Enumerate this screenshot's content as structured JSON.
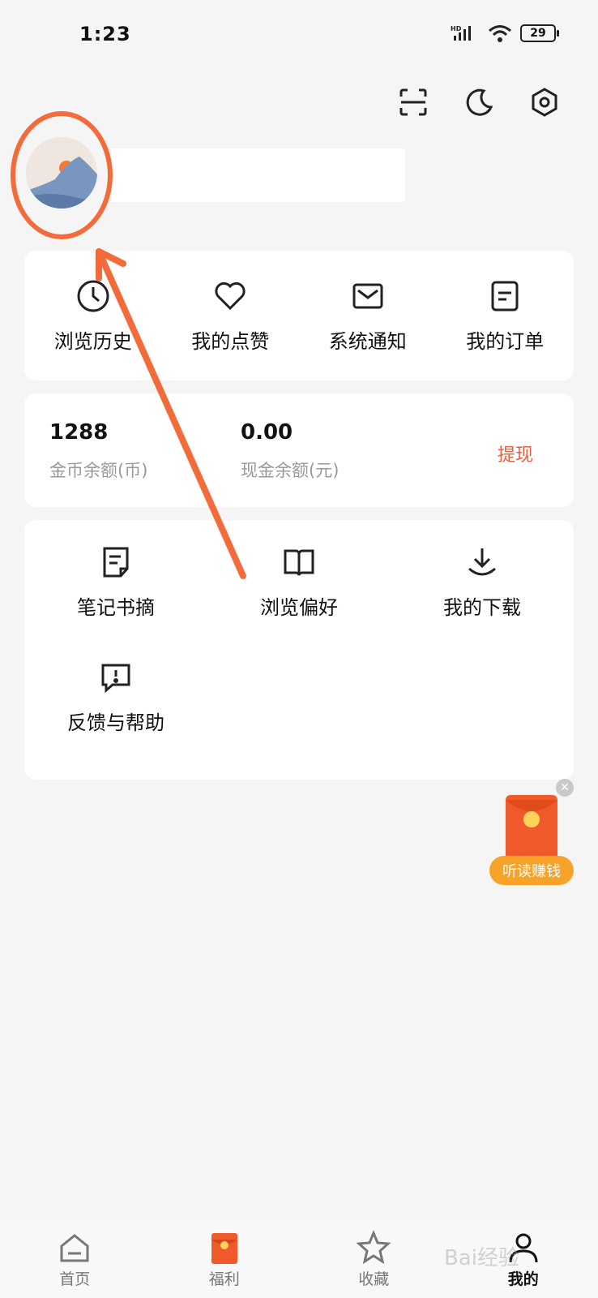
{
  "status_bar": {
    "time": "1:23",
    "battery": "29",
    "network": "HD"
  },
  "quick_actions": [
    {
      "label": "浏览历史",
      "icon": "clock-icon"
    },
    {
      "label": "我的点赞",
      "icon": "heart-icon"
    },
    {
      "label": "系统通知",
      "icon": "mail-icon"
    },
    {
      "label": "我的订单",
      "icon": "order-icon"
    }
  ],
  "balance": {
    "coins": "1288",
    "coins_label": "金币余额(币)",
    "cash": "0.00",
    "cash_label": "现金余额(元)",
    "withdraw_label": "提现"
  },
  "tools": [
    {
      "label": "笔记书摘",
      "icon": "note-icon"
    },
    {
      "label": "浏览偏好",
      "icon": "book-icon"
    },
    {
      "label": "我的下载",
      "icon": "download-icon"
    },
    {
      "label": "反馈与帮助",
      "icon": "feedback-icon"
    }
  ],
  "floating": {
    "label": "听读赚钱"
  },
  "bottom_nav": [
    {
      "label": "首页",
      "icon": "home-icon"
    },
    {
      "label": "福利",
      "icon": "gift-icon"
    },
    {
      "label": "收藏",
      "icon": "star-icon"
    },
    {
      "label": "我的",
      "icon": "user-icon"
    }
  ],
  "watermark": "Bai经验",
  "colors": {
    "accent": "#f26b3a",
    "orange": "#f05a2a",
    "pill": "#f7a329",
    "withdraw": "#e8603c"
  }
}
